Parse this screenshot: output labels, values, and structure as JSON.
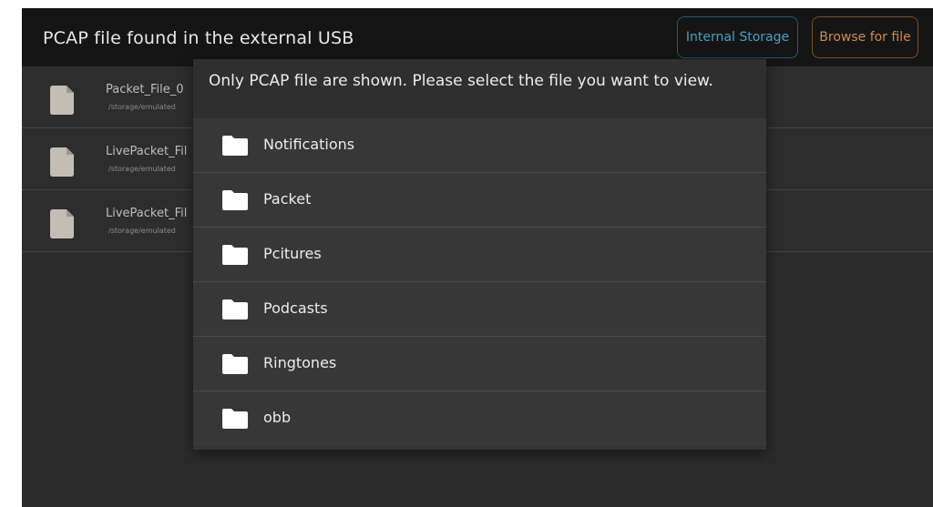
{
  "header": {
    "title": "PCAP file found in the external USB",
    "internal_storage_label": "Internal Storage",
    "browse_label": "Browse for file"
  },
  "files": [
    {
      "name": "Packet_File_0",
      "path": "/storage/emulated"
    },
    {
      "name": "LivePacket_Fil",
      "path": "/storage/emulated"
    },
    {
      "name": "LivePacket_Fil",
      "path": "/storage/emulated"
    }
  ],
  "dialog": {
    "message": "Only PCAP file are shown. Please select the file you want to view.",
    "folders": [
      {
        "label": "Notifications"
      },
      {
        "label": "Packet"
      },
      {
        "label": "Pcitures"
      },
      {
        "label": "Podcasts"
      },
      {
        "label": "Ringtones"
      },
      {
        "label": "obb"
      }
    ]
  },
  "icons": {
    "file": "file-icon",
    "folder": "folder-icon"
  },
  "colors": {
    "internal_storage_accent": "#3fa4c8",
    "browse_accent": "#d08a43"
  }
}
